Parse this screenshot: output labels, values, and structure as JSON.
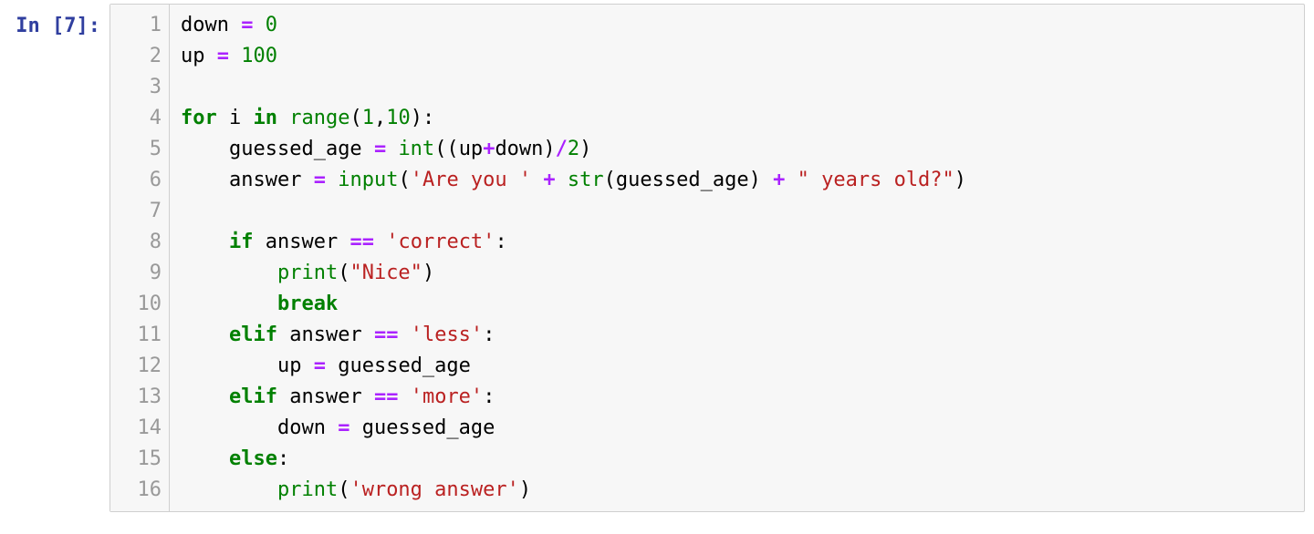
{
  "prompt": {
    "in_label": "In ",
    "open_bracket": "[",
    "exec_count": "7",
    "close_bracket": "]",
    "colon": ":"
  },
  "gutter_numbers": [
    "1",
    "2",
    "3",
    "4",
    "5",
    "6",
    "7",
    "8",
    "9",
    "10",
    "11",
    "12",
    "13",
    "14",
    "15",
    "16"
  ],
  "colors": {
    "prompt": "#303F9F",
    "keyword": "#008000",
    "builtin": "#008000",
    "number": "#008000",
    "string": "#BA2121",
    "operator": "#AA22FF",
    "gutter": "#999999",
    "bg": "#f7f7f7",
    "border": "#cfcfcf"
  },
  "code": {
    "lines": [
      [
        {
          "cls": "tok-name",
          "t": "down"
        },
        {
          "cls": "tok-op",
          "t": " "
        },
        {
          "cls": "tok-op-arith",
          "t": "="
        },
        {
          "cls": "tok-op",
          "t": " "
        },
        {
          "cls": "tok-number",
          "t": "0"
        }
      ],
      [
        {
          "cls": "tok-name",
          "t": "up"
        },
        {
          "cls": "tok-op",
          "t": " "
        },
        {
          "cls": "tok-op-arith",
          "t": "="
        },
        {
          "cls": "tok-op",
          "t": " "
        },
        {
          "cls": "tok-number",
          "t": "100"
        }
      ],
      [
        {
          "cls": "tok-op",
          "t": ""
        }
      ],
      [
        {
          "cls": "tok-keyword",
          "t": "for"
        },
        {
          "cls": "tok-op",
          "t": " "
        },
        {
          "cls": "tok-name",
          "t": "i"
        },
        {
          "cls": "tok-op",
          "t": " "
        },
        {
          "cls": "tok-keyword",
          "t": "in"
        },
        {
          "cls": "tok-op",
          "t": " "
        },
        {
          "cls": "tok-builtin",
          "t": "range"
        },
        {
          "cls": "tok-punct",
          "t": "("
        },
        {
          "cls": "tok-number",
          "t": "1"
        },
        {
          "cls": "tok-punct",
          "t": ","
        },
        {
          "cls": "tok-number",
          "t": "10"
        },
        {
          "cls": "tok-punct",
          "t": ")"
        },
        {
          "cls": "tok-punct",
          "t": ":"
        }
      ],
      [
        {
          "cls": "tok-op",
          "t": "    "
        },
        {
          "cls": "tok-name",
          "t": "guessed_age"
        },
        {
          "cls": "tok-op",
          "t": " "
        },
        {
          "cls": "tok-op-arith",
          "t": "="
        },
        {
          "cls": "tok-op",
          "t": " "
        },
        {
          "cls": "tok-builtin",
          "t": "int"
        },
        {
          "cls": "tok-punct",
          "t": "(("
        },
        {
          "cls": "tok-name",
          "t": "up"
        },
        {
          "cls": "tok-op-arith",
          "t": "+"
        },
        {
          "cls": "tok-name",
          "t": "down"
        },
        {
          "cls": "tok-punct",
          "t": ")"
        },
        {
          "cls": "tok-op-arith",
          "t": "/"
        },
        {
          "cls": "tok-number",
          "t": "2"
        },
        {
          "cls": "tok-punct",
          "t": ")"
        }
      ],
      [
        {
          "cls": "tok-op",
          "t": "    "
        },
        {
          "cls": "tok-name",
          "t": "answer"
        },
        {
          "cls": "tok-op",
          "t": " "
        },
        {
          "cls": "tok-op-arith",
          "t": "="
        },
        {
          "cls": "tok-op",
          "t": " "
        },
        {
          "cls": "tok-builtin",
          "t": "input"
        },
        {
          "cls": "tok-punct",
          "t": "("
        },
        {
          "cls": "tok-string",
          "t": "'Are you '"
        },
        {
          "cls": "tok-op",
          "t": " "
        },
        {
          "cls": "tok-op-arith",
          "t": "+"
        },
        {
          "cls": "tok-op",
          "t": " "
        },
        {
          "cls": "tok-builtin",
          "t": "str"
        },
        {
          "cls": "tok-punct",
          "t": "("
        },
        {
          "cls": "tok-name",
          "t": "guessed_age"
        },
        {
          "cls": "tok-punct",
          "t": ")"
        },
        {
          "cls": "tok-op",
          "t": " "
        },
        {
          "cls": "tok-op-arith",
          "t": "+"
        },
        {
          "cls": "tok-op",
          "t": " "
        },
        {
          "cls": "tok-string",
          "t": "\" years old?\""
        },
        {
          "cls": "tok-punct",
          "t": ")"
        }
      ],
      [
        {
          "cls": "tok-op",
          "t": "    "
        }
      ],
      [
        {
          "cls": "tok-op",
          "t": "    "
        },
        {
          "cls": "tok-keyword",
          "t": "if"
        },
        {
          "cls": "tok-op",
          "t": " "
        },
        {
          "cls": "tok-name",
          "t": "answer"
        },
        {
          "cls": "tok-op",
          "t": " "
        },
        {
          "cls": "tok-op-arith",
          "t": "=="
        },
        {
          "cls": "tok-op",
          "t": " "
        },
        {
          "cls": "tok-string",
          "t": "'correct'"
        },
        {
          "cls": "tok-punct",
          "t": ":"
        }
      ],
      [
        {
          "cls": "tok-op",
          "t": "        "
        },
        {
          "cls": "tok-builtin",
          "t": "print"
        },
        {
          "cls": "tok-punct",
          "t": "("
        },
        {
          "cls": "tok-string",
          "t": "\"Nice\""
        },
        {
          "cls": "tok-punct",
          "t": ")"
        }
      ],
      [
        {
          "cls": "tok-op",
          "t": "        "
        },
        {
          "cls": "tok-keyword",
          "t": "break"
        }
      ],
      [
        {
          "cls": "tok-op",
          "t": "    "
        },
        {
          "cls": "tok-keyword",
          "t": "elif"
        },
        {
          "cls": "tok-op",
          "t": " "
        },
        {
          "cls": "tok-name",
          "t": "answer"
        },
        {
          "cls": "tok-op",
          "t": " "
        },
        {
          "cls": "tok-op-arith",
          "t": "=="
        },
        {
          "cls": "tok-op",
          "t": " "
        },
        {
          "cls": "tok-string",
          "t": "'less'"
        },
        {
          "cls": "tok-punct",
          "t": ":"
        }
      ],
      [
        {
          "cls": "tok-op",
          "t": "        "
        },
        {
          "cls": "tok-name",
          "t": "up"
        },
        {
          "cls": "tok-op",
          "t": " "
        },
        {
          "cls": "tok-op-arith",
          "t": "="
        },
        {
          "cls": "tok-op",
          "t": " "
        },
        {
          "cls": "tok-name",
          "t": "guessed_age"
        }
      ],
      [
        {
          "cls": "tok-op",
          "t": "    "
        },
        {
          "cls": "tok-keyword",
          "t": "elif"
        },
        {
          "cls": "tok-op",
          "t": " "
        },
        {
          "cls": "tok-name",
          "t": "answer"
        },
        {
          "cls": "tok-op",
          "t": " "
        },
        {
          "cls": "tok-op-arith",
          "t": "=="
        },
        {
          "cls": "tok-op",
          "t": " "
        },
        {
          "cls": "tok-string",
          "t": "'more'"
        },
        {
          "cls": "tok-punct",
          "t": ":"
        }
      ],
      [
        {
          "cls": "tok-op",
          "t": "        "
        },
        {
          "cls": "tok-name",
          "t": "down"
        },
        {
          "cls": "tok-op",
          "t": " "
        },
        {
          "cls": "tok-op-arith",
          "t": "="
        },
        {
          "cls": "tok-op",
          "t": " "
        },
        {
          "cls": "tok-name",
          "t": "guessed_age"
        }
      ],
      [
        {
          "cls": "tok-op",
          "t": "    "
        },
        {
          "cls": "tok-keyword",
          "t": "else"
        },
        {
          "cls": "tok-punct",
          "t": ":"
        }
      ],
      [
        {
          "cls": "tok-op",
          "t": "        "
        },
        {
          "cls": "tok-builtin",
          "t": "print"
        },
        {
          "cls": "tok-punct",
          "t": "("
        },
        {
          "cls": "tok-string",
          "t": "'wrong answer'"
        },
        {
          "cls": "tok-punct",
          "t": ")"
        }
      ]
    ]
  }
}
